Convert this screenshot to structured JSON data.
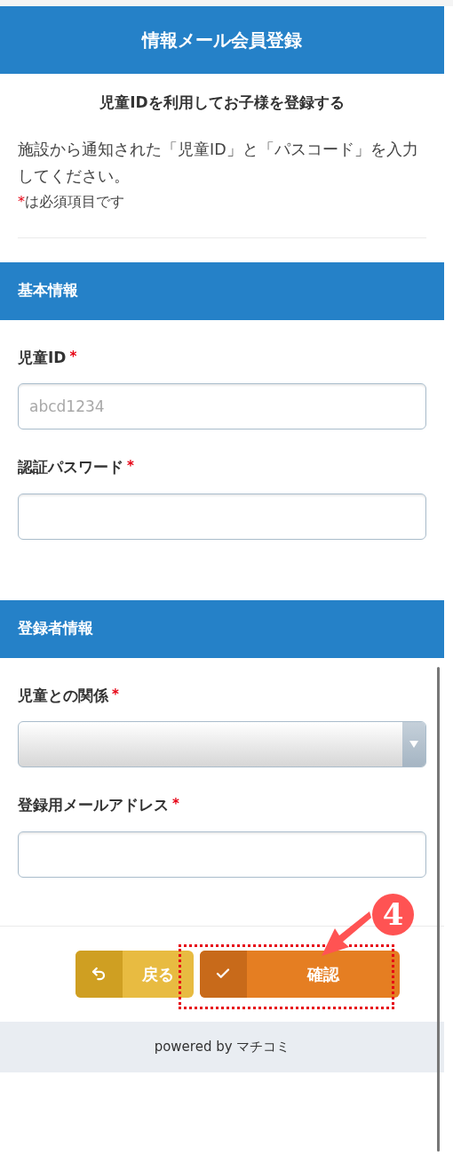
{
  "header": {
    "title": "情報メール会員登録"
  },
  "intro": {
    "heading": "児童IDを利用してお子様を登録する",
    "text": "施設から通知された「児童ID」と「パスコード」を入力してください。",
    "required_note": {
      "mark": "*",
      "text": "は必須項目です"
    }
  },
  "sections": [
    {
      "title": "基本情報",
      "fields": [
        {
          "kind": "text",
          "label": "児童ID",
          "required_mark": "*",
          "placeholder": "abcd1234"
        },
        {
          "kind": "text",
          "label": "認証パスワード",
          "required_mark": "*"
        }
      ]
    },
    {
      "title": "登録者情報",
      "fields": [
        {
          "kind": "select",
          "label": "児童との関係",
          "required_mark": "*"
        },
        {
          "kind": "text",
          "label": "登録用メールアドレス",
          "required_mark": "*"
        }
      ]
    }
  ],
  "buttons": [
    {
      "kind": "back",
      "label": "戻る"
    },
    {
      "kind": "confirm",
      "label": "確認"
    }
  ],
  "footer": "powered by マチコミ",
  "annotation": {
    "number": "4"
  }
}
